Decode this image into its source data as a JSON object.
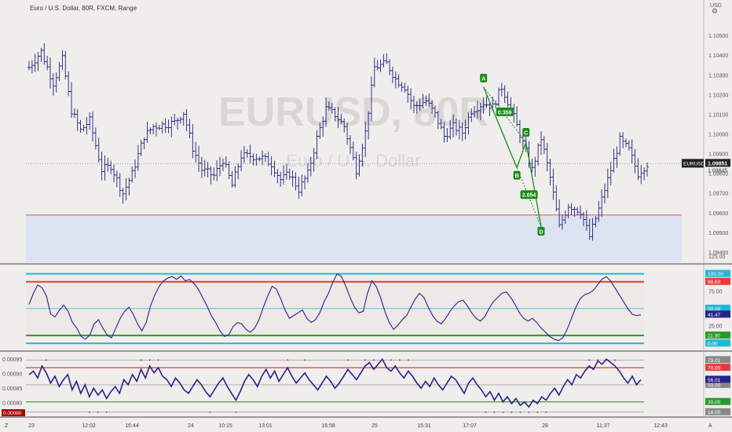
{
  "title": "Euro / U.S. Dollar, 80R, FXCM, Range",
  "watermark": {
    "symbol": "EURUSD, 80R",
    "name": "Euro / U.S. Dollar"
  },
  "currency": "USD",
  "time_axis": {
    "labels": [
      "23",
      "12:02",
      "16:44",
      "24",
      "10:15",
      "13:01",
      "16:58",
      "25",
      "15:31",
      "17:07",
      "28",
      "11:37",
      "12:43"
    ],
    "left_btn": "Z",
    "right_btn": "A"
  },
  "colors": {
    "bar": "#2a2ab0",
    "pattern": "#1a8c1a",
    "rsi": "#25238c",
    "red": "#e83a3a",
    "cyan": "#22b8d4",
    "green": "#2a9a2a",
    "zone": "#dde3f0"
  },
  "chart_data": [
    {
      "type": "ohlc",
      "name": "price",
      "ylim": [
        1.0935,
        1.1065
      ],
      "y_ticks": [
        "1.10500",
        "1.10400",
        "1.10300",
        "1.10200",
        "1.10100",
        "1.10000",
        "1.09900",
        "1.09800",
        "1.09700",
        "1.09600",
        "1.09500",
        "1.09400"
      ],
      "last_price": {
        "symbol": "EURUSD",
        "value": "1.09851",
        "sub": "1.09845"
      },
      "support_line": 1.0959,
      "support_zone": [
        1.0935,
        1.0959
      ],
      "close_path": [
        [
          0,
          1.1034
        ],
        [
          4,
          1.1042
        ],
        [
          8,
          1.1026
        ],
        [
          11,
          1.1038
        ],
        [
          14,
          1.1012
        ],
        [
          17,
          1.1002
        ],
        [
          20,
          1.1007
        ],
        [
          24,
          1.0982
        ],
        [
          27,
          1.0984
        ],
        [
          31,
          1.097
        ],
        [
          34,
          1.098
        ],
        [
          38,
          1.0999
        ],
        [
          41,
          1.1004
        ],
        [
          45,
          1.1005
        ],
        [
          48,
          1.1006
        ],
        [
          51,
          1.1011
        ],
        [
          54,
          1.0993
        ],
        [
          57,
          1.0982
        ],
        [
          61,
          1.0979
        ],
        [
          64,
          1.0987
        ],
        [
          67,
          1.0974
        ],
        [
          70,
          1.0989
        ],
        [
          73,
          1.0989
        ],
        [
          77,
          1.0988
        ],
        [
          80,
          1.0985
        ],
        [
          83,
          1.0977
        ],
        [
          86,
          1.098
        ],
        [
          89,
          1.0972
        ],
        [
          92,
          1.098
        ],
        [
          95,
          1.0998
        ],
        [
          98,
          1.1013
        ],
        [
          101,
          1.101
        ],
        [
          104,
          1.1004
        ],
        [
          108,
          1.0982
        ],
        [
          111,
          1.1001
        ],
        [
          114,
          1.1034
        ],
        [
          118,
          1.1036
        ],
        [
          121,
          1.1028
        ],
        [
          124,
          1.1024
        ],
        [
          127,
          1.1014
        ],
        [
          131,
          1.1017
        ],
        [
          134,
          1.101
        ],
        [
          137,
          1.0999
        ],
        [
          140,
          1.1004
        ],
        [
          143,
          1.1001
        ],
        [
          146,
          1.1012
        ],
        [
          150,
          1.1016
        ],
        [
          153,
          1.1014
        ],
        [
          156,
          1.1024
        ],
        [
          159,
          1.1013
        ],
        [
          162,
          1.1
        ],
        [
          166,
          1.0982
        ],
        [
          169,
          1.0998
        ],
        [
          172,
          1.0978
        ],
        [
          175,
          1.0953
        ],
        [
          178,
          1.0964
        ],
        [
          182,
          1.0961
        ],
        [
          185,
          1.0948
        ],
        [
          188,
          1.0962
        ],
        [
          191,
          1.0977
        ],
        [
          195,
          1.0997
        ],
        [
          198,
          1.0992
        ],
        [
          201,
          1.098
        ],
        [
          204,
          1.0985
        ]
      ]
    },
    {
      "type": "harmonic-pattern",
      "points": [
        {
          "label": "A",
          "x": 150,
          "y": 1.1024
        },
        {
          "label": "B",
          "x": 161,
          "y": 1.0983
        },
        {
          "label": "C",
          "x": 164,
          "y": 1.0996
        },
        {
          "label": "D",
          "x": 169,
          "y": 1.0953
        }
      ],
      "ratios": [
        "0.359",
        "2.654"
      ]
    },
    {
      "type": "line",
      "name": "oscillator",
      "ylim": [
        -10,
        112
      ],
      "y_ticks": [
        "125.00",
        "100.00",
        "75.00",
        "50.00",
        "25.00",
        "0.00"
      ],
      "levels": [
        {
          "value": "100.00",
          "color": "#22b8d4"
        },
        {
          "value": "88.60",
          "color": "#e83a3a"
        },
        {
          "value": "50.00",
          "color": "#22b8d4"
        },
        {
          "value": "11.30",
          "color": "#2a9a2a"
        },
        {
          "value": "0.00",
          "color": "#22b8d4"
        }
      ],
      "last": "41.47",
      "values": [
        56,
        72,
        84,
        80,
        68,
        42,
        38,
        48,
        55,
        46,
        30,
        22,
        10,
        6,
        12,
        28,
        34,
        22,
        12,
        8,
        22,
        36,
        46,
        52,
        42,
        28,
        18,
        30,
        54,
        70,
        82,
        90,
        94,
        96,
        92,
        97,
        90,
        92,
        86,
        78,
        66,
        54,
        40,
        30,
        18,
        10,
        12,
        24,
        30,
        28,
        20,
        16,
        22,
        34,
        52,
        68,
        82,
        78,
        64,
        48,
        36,
        40,
        44,
        48,
        36,
        30,
        34,
        44,
        60,
        72,
        88,
        100,
        96,
        82,
        66,
        52,
        44,
        46,
        72,
        90,
        82,
        66,
        46,
        30,
        20,
        26,
        34,
        40,
        52,
        64,
        72,
        66,
        52,
        40,
        32,
        28,
        36,
        46,
        54,
        60,
        62,
        54,
        44,
        36,
        32,
        38,
        50,
        60,
        66,
        72,
        74,
        66,
        56,
        44,
        36,
        32,
        36,
        30,
        22,
        16,
        10,
        6,
        4,
        8,
        20,
        36,
        52,
        64,
        70,
        72,
        76,
        84,
        92,
        96,
        90,
        80,
        70,
        60,
        50,
        42,
        40,
        41
      ]
    },
    {
      "type": "line",
      "name": "indicator-2",
      "ylim": [
        15,
        83
      ],
      "y_ticks": [
        "0.00095",
        "0.00090",
        "0.00085",
        "0.00080"
      ],
      "red_value_label": "0.00080",
      "levels": [
        {
          "value": "79.01",
          "color": "#888888"
        },
        {
          "value": "70.00",
          "color": "#e83a3a"
        },
        {
          "value": "50.00",
          "color": "#888888"
        },
        {
          "value": "30.00",
          "color": "#2a9a2a"
        },
        {
          "value": "18.00",
          "color": "#888888"
        }
      ],
      "last": "56.01",
      "values": [
        62,
        66,
        58,
        72,
        64,
        52,
        60,
        48,
        56,
        62,
        44,
        54,
        40,
        50,
        36,
        46,
        38,
        44,
        34,
        42,
        48,
        40,
        56,
        50,
        62,
        54,
        68,
        58,
        72,
        64,
        70,
        60,
        56,
        48,
        58,
        52,
        44,
        40,
        48,
        56,
        50,
        42,
        36,
        44,
        52,
        58,
        48,
        40,
        32,
        42,
        54,
        62,
        56,
        48,
        60,
        68,
        58,
        66,
        54,
        62,
        70,
        60,
        52,
        58,
        64,
        56,
        50,
        44,
        52,
        60,
        54,
        46,
        52,
        60,
        68,
        62,
        56,
        64,
        72,
        76,
        68,
        74,
        80,
        70,
        66,
        72,
        64,
        58,
        66,
        60,
        52,
        46,
        54,
        48,
        58,
        50,
        44,
        52,
        60,
        56,
        48,
        40,
        52,
        58,
        50,
        44,
        36,
        42,
        32,
        40,
        30,
        36,
        28,
        34,
        26,
        30,
        24,
        32,
        28,
        36,
        32,
        40,
        46,
        38,
        48,
        56,
        50,
        62,
        58,
        66,
        72,
        68,
        78,
        74,
        80,
        76,
        72,
        66,
        58,
        52,
        60,
        50,
        56
      ]
    }
  ]
}
